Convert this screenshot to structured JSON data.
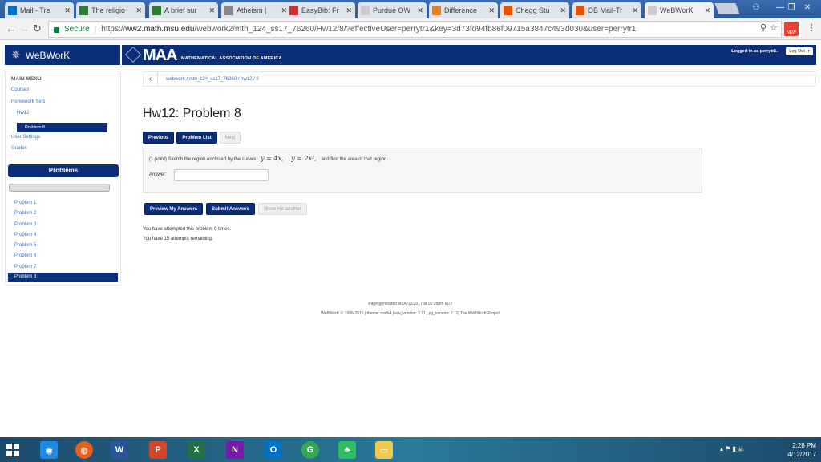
{
  "browser": {
    "tabs": [
      {
        "label": "Mail - Tre",
        "icon": "mail-icon",
        "color": "#0072c6",
        "active": false
      },
      {
        "label": "The religio",
        "icon": "sheet-icon",
        "color": "#2e7d32",
        "active": false
      },
      {
        "label": "A brief sur",
        "icon": "sheet-icon",
        "color": "#2e7d32",
        "active": false
      },
      {
        "label": "Atheism |",
        "icon": "globe-icon",
        "color": "#888888",
        "active": false
      },
      {
        "label": "EasyBib: Fr",
        "icon": "easybib-icon",
        "color": "#d32f2f",
        "active": false
      },
      {
        "label": "Purdue OW",
        "icon": "blank-icon",
        "color": "#cccccc",
        "active": false
      },
      {
        "label": "Difference",
        "icon": "difference-icon",
        "color": "#e67e22",
        "active": false
      },
      {
        "label": "Chegg Stu",
        "icon": "chegg-icon",
        "color": "#e65100",
        "active": false
      },
      {
        "label": "OB Mail-Tr",
        "icon": "chegg-icon",
        "color": "#e65100",
        "active": false
      },
      {
        "label": "WeBWorK",
        "icon": "page-icon",
        "color": "#cccccc",
        "active": true
      }
    ],
    "secure_label": "Secure",
    "url_prefix": "https://",
    "url_host": "ww2.math.msu.edu",
    "url_path": "/webwork2/mth_124_ss17_76260/Hw12/8/?effectiveUser=perrytr1&key=3d73fd94fb86f09715a3847c493d030&user=perrytr1",
    "extension_badge": "NEW"
  },
  "header": {
    "brand": "WeBWorK",
    "maa_logo": "MAA",
    "maa_subtitle": "MATHEMATICAL ASSOCIATION OF AMERICA",
    "logged_in": "Logged in as perrytr1.",
    "logout": "Log Out ➜"
  },
  "sidebar": {
    "heading": "MAIN MENU",
    "courses": "Courses",
    "homework_sets": "Homework Sets",
    "hw": "Hw12",
    "active_problem": "Problem 8",
    "user_settings": "User Settings",
    "grades": "Grades",
    "problems_heading": "Problems",
    "problems": [
      "Problem 1",
      "Problem 2",
      "Problem 3",
      "Problem 4",
      "Problem 5",
      "Problem 6",
      "Problem 7",
      "Problem 8"
    ]
  },
  "main": {
    "breadcrumb": "webwork / mth_124_ss17_76260 / hw12 / 8",
    "title": "Hw12: Problem 8",
    "nav": {
      "previous": "Previous",
      "problem_list": "Problem List",
      "next": "Next"
    },
    "problem": {
      "prefix": "(1 point) Sketch the region enclosed by the curves",
      "curve1": "y = 4x,",
      "curve2": "y = 2x²,",
      "suffix": "and find the area of that region."
    },
    "answer_label": "Answer:",
    "buttons": {
      "preview": "Preview My Answers",
      "submit": "Submit Answers",
      "show_another": "Show me another"
    },
    "attempts": "You have attempted this problem 0 times.",
    "remaining": "You have 15 attempts remaining."
  },
  "footer": {
    "generated": "Page generated at 04/12/2017 at 02:28pm EDT",
    "copyright": "WeBWorK © 1996-2016 | theme: math4 | ww_version: 2.11 | pg_version: 2.11| The WeBWorK Project"
  },
  "taskbar": {
    "time": "2:28 PM",
    "date": "4/12/2017"
  }
}
